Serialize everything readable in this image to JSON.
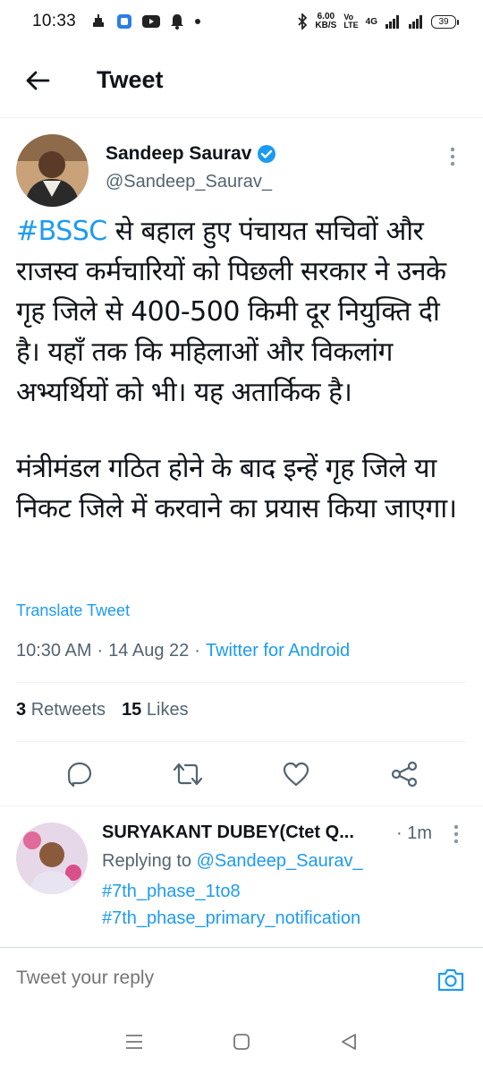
{
  "status_bar": {
    "time": "10:33",
    "net_speed_value": "6.00",
    "net_speed_unit": "KB/S",
    "volte": "VoLTE",
    "network": "4G",
    "battery": "39"
  },
  "header": {
    "title": "Tweet"
  },
  "tweet": {
    "author_name": "Sandeep Saurav",
    "author_handle": "@Sandeep_Saurav_",
    "hashtag": "#BSSC",
    "text_part1": " से बहाल हुए पंचायत सचिवों और राजस्व कर्मचारियों को पिछली सरकार ने उनके गृह जिले से 400-500 किमी दूर नियुक्ति दी है। यहाँ तक कि महिलाओं और विकलांग अभ्यर्थियों को भी। यह अतार्किक है।",
    "text_part2": "मंत्रीमंडल गठित होने के बाद इन्हें गृह जिले या निकट जिले में करवाने का प्रयास किया जाएगा।",
    "translate_label": "Translate Tweet",
    "time": "10:30 AM",
    "date": "14 Aug 22",
    "separator": "·",
    "source": "Twitter for Android",
    "retweets_count": "3",
    "retweets_label": "Retweets",
    "likes_count": "15",
    "likes_label": "Likes"
  },
  "reply": {
    "author_name": "SURYAKANT DUBEY(Ctet Q...",
    "time": "· 1m",
    "replying_to_label": "Replying to",
    "replying_to_handle": "@Sandeep_Saurav_",
    "hashtags": [
      "#7th_phase_1to8",
      "#7th_phase_primary_notification"
    ]
  },
  "composer": {
    "placeholder": "Tweet your reply"
  },
  "colors": {
    "accent": "#1d9bf0",
    "text": "#0f1419",
    "secondary": "#536471"
  }
}
